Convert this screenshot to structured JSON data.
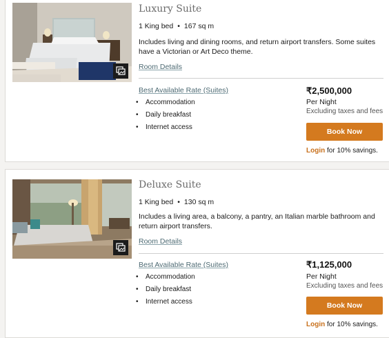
{
  "rooms": [
    {
      "name": "Luxury Suite",
      "bed": "1 King bed",
      "separator": "•",
      "size": "167 sq m",
      "description": "Includes living and dining rooms, and return airport transfers. Some suites have a Victorian or Art Deco theme.",
      "details_link": "Room Details",
      "rate_name": "Best Available Rate (Suites)",
      "inclusions": [
        "Accommodation",
        "Daily breakfast",
        "Internet access"
      ],
      "bullet": "•",
      "price": "₹2,500,000",
      "per_night": "Per Night",
      "tax_note": "Excluding taxes and fees",
      "book_label": "Book Now",
      "login_label": "Login",
      "login_suffix": " for 10% savings."
    },
    {
      "name": "Deluxe Suite",
      "bed": "1 King bed",
      "separator": "•",
      "size": "130 sq m",
      "description": "Includes a living area, a balcony, a pantry, an Italian marble bathroom and return airport transfers.",
      "details_link": "Room Details",
      "rate_name": "Best Available Rate (Suites)",
      "inclusions": [
        "Accommodation",
        "Daily breakfast",
        "Internet access"
      ],
      "bullet": "•",
      "price": "₹1,125,000",
      "per_night": "Per Night",
      "tax_note": "Excluding taxes and fees",
      "book_label": "Book Now",
      "login_label": "Login",
      "login_suffix": " for 10% savings."
    }
  ],
  "colors": {
    "accent_orange": "#d47a1f",
    "link_teal": "#4d6a73",
    "login_orange": "#c8701b"
  },
  "icons": {
    "gallery": "gallery-icon"
  }
}
